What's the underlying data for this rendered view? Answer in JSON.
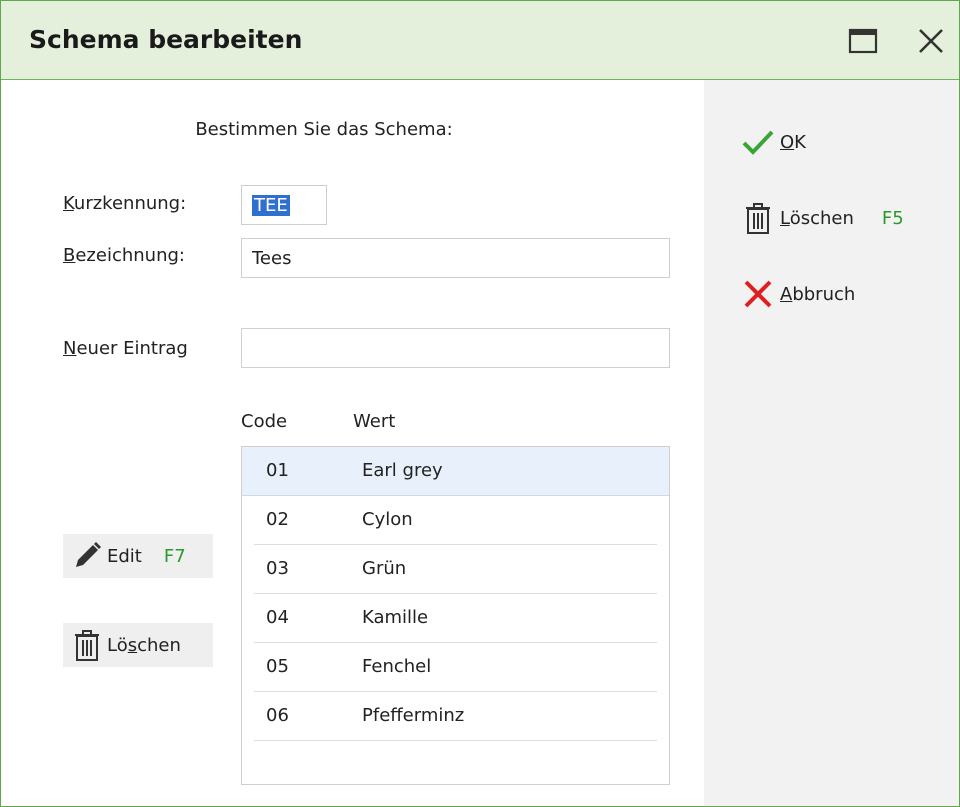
{
  "window": {
    "title": "Schema bearbeiten"
  },
  "form": {
    "heading": "Bestimmen Sie das Schema:",
    "kurzkennung": {
      "label_ul": "K",
      "label_rest": "urzkennung:",
      "value": "TEE"
    },
    "bezeichnung": {
      "label_ul": "B",
      "label_rest": "ezeichnung:",
      "value": "Tees"
    },
    "neuer_eintrag": {
      "label_ul": "N",
      "label_rest": "euer Eintrag",
      "value": ""
    }
  },
  "table": {
    "columns": [
      "Code",
      "Wert"
    ],
    "rows": [
      {
        "code": "01",
        "wert": "Earl grey"
      },
      {
        "code": "02",
        "wert": "Cylon"
      },
      {
        "code": "03",
        "wert": "Grün"
      },
      {
        "code": "04",
        "wert": "Kamille"
      },
      {
        "code": "05",
        "wert": "Fenchel"
      },
      {
        "code": "06",
        "wert": "Pfefferminz"
      }
    ]
  },
  "left_buttons": {
    "edit": {
      "label": "Edit",
      "key": "F7",
      "icon": "pencil-icon"
    },
    "delete": {
      "label_a": "Lö",
      "label_ul": "s",
      "label_b": "chen",
      "icon": "trash-icon"
    }
  },
  "actions": {
    "ok": {
      "label_ul": "O",
      "label_rest": "K",
      "icon": "checkmark-icon"
    },
    "delete": {
      "label_ul": "L",
      "label_rest": "öschen",
      "key": "F5",
      "icon": "trash-icon"
    },
    "cancel": {
      "label_ul": "A",
      "label_rest": "bbruch",
      "icon": "x-icon"
    }
  },
  "colors": {
    "titlebar_bg": "#e4f0dc",
    "border_green": "#5fa94a",
    "selection_blue": "#2f6fd0",
    "key_green": "#2b9a2b",
    "cancel_red": "#e02020",
    "ok_green": "#3aa535"
  }
}
